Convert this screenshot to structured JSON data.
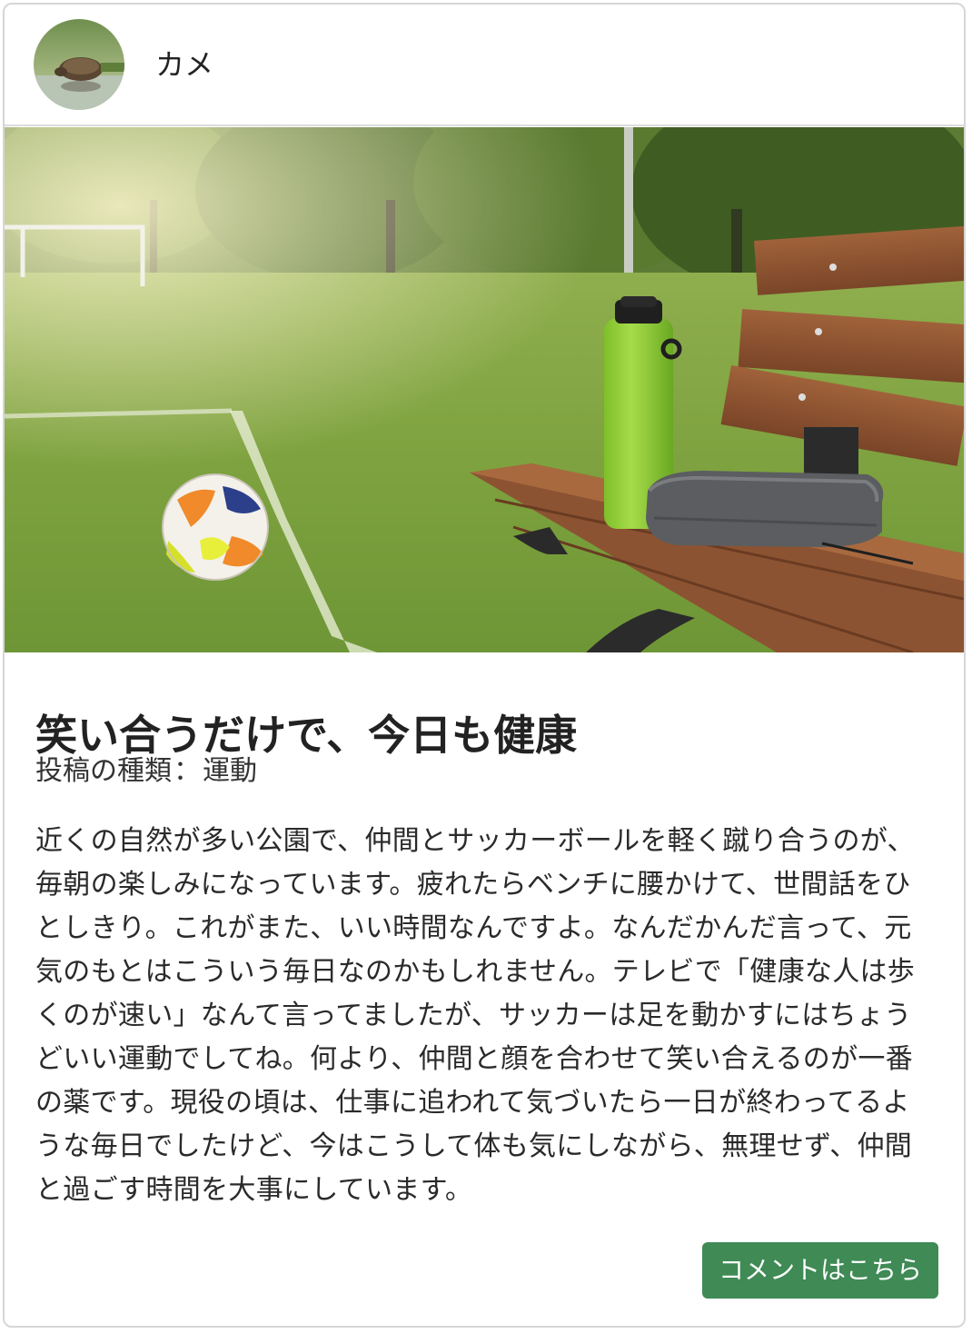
{
  "author": {
    "name": "カメ",
    "avatar_icon": "turtle-avatar-icon"
  },
  "post": {
    "photo_icon": "park-soccer-bench-photo",
    "title": "笑い合うだけで、今日も健康",
    "type_label": "投稿の種類",
    "type_separator": "：",
    "type_value": "運動",
    "body": "近くの自然が多い公園で、仲間とサッカーボールを軽く蹴り合うのが、毎朝の楽しみになっています。疲れたらベンチに腰かけて、世間話をひとしきり。これがまた、いい時間なんですよ。なんだかんだ言って、元気のもとはこういう毎日なのかもしれません。テレビで「健康な人は歩くのが速い」なんて言ってましたが、サッカーは足を動かすにはちょうどいい運動でしてね。何より、仲間と顔を合わせて笑い合えるのが一番の薬です。現役の頃は、仕事に追われて気づいたら一日が終わってるような毎日でしたけど、今はこうして体も気にしながら、無理せず、仲間と過ごす時間を大事にしています。"
  },
  "actions": {
    "comment_label": "コメントはこちら"
  },
  "colors": {
    "button_bg": "#3f8a55",
    "border": "#d6d6d6"
  }
}
